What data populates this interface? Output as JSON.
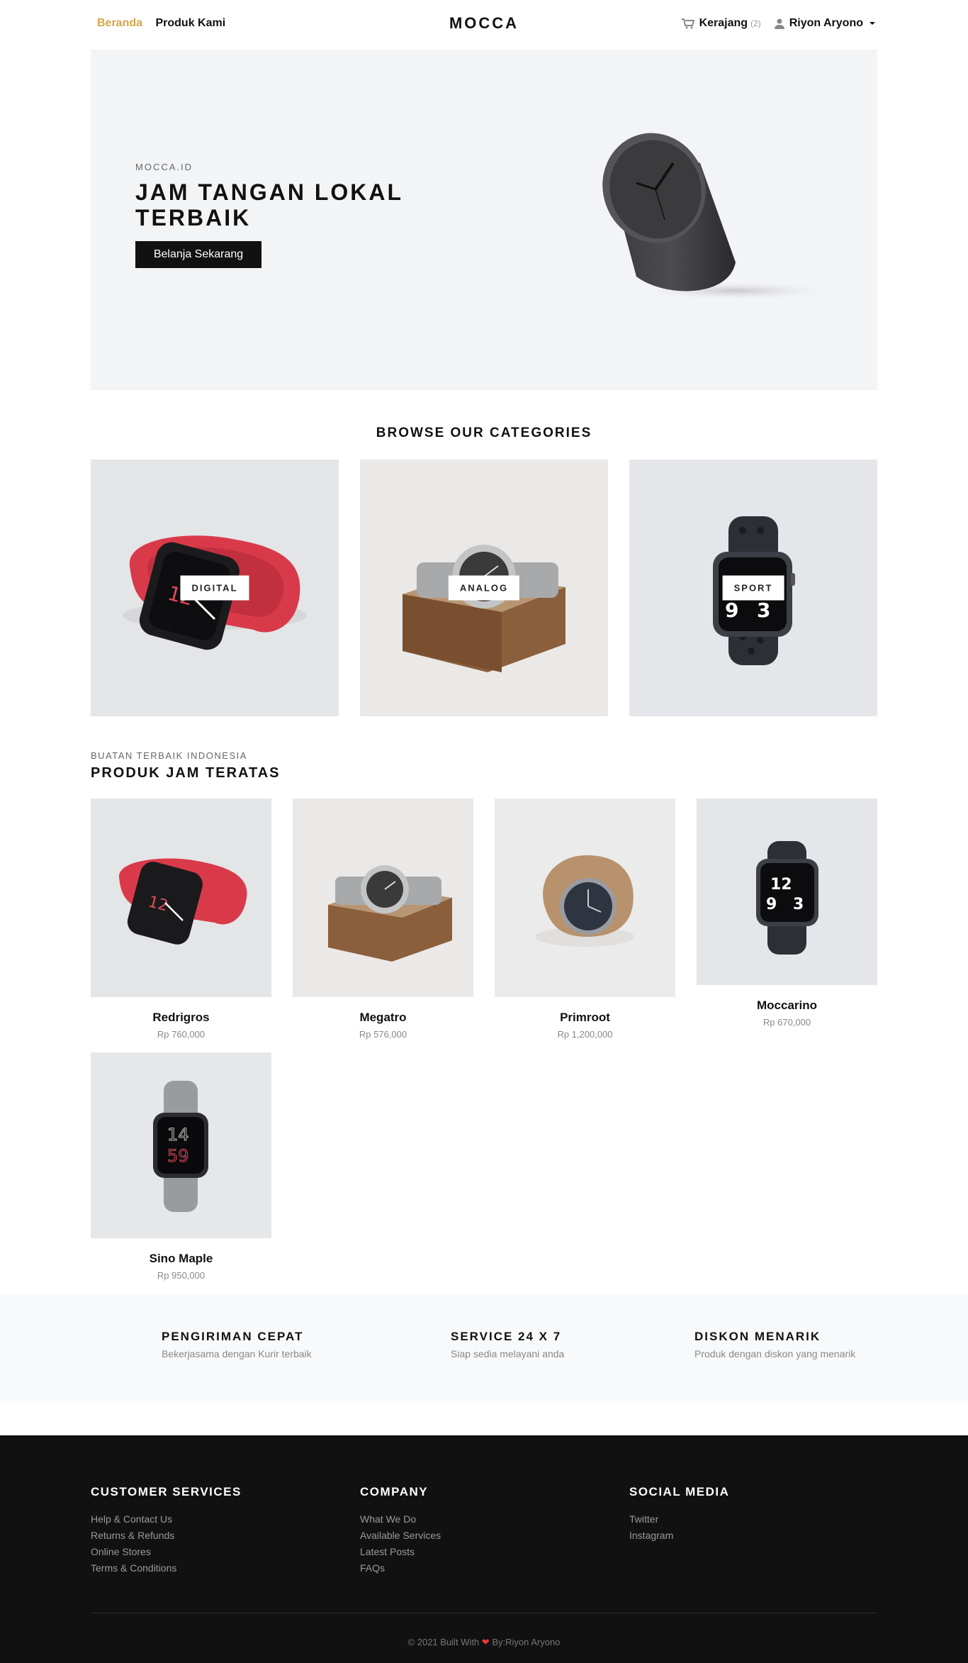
{
  "nav": {
    "home": "Beranda",
    "products": "Produk Kami",
    "brand": "MOCCA",
    "cart_label": "Kerajang",
    "cart_count": "(2)",
    "user_name": "Riyon Aryono"
  },
  "hero": {
    "eyebrow": "MOCCA.ID",
    "title": "JAM TANGAN LOKAL TERBAIK",
    "button": "Belanja Sekarang"
  },
  "categories": {
    "title": "BROWSE OUR CATEGORIES",
    "items": [
      {
        "label": "DIGITAL"
      },
      {
        "label": "ANALOG"
      },
      {
        "label": "SPORT"
      }
    ]
  },
  "products": {
    "eyebrow": "BUATAN TERBAIK INDONESIA",
    "title": "PRODUK JAM TERATAS",
    "items": [
      {
        "name": "Redrigros",
        "price": "Rp 760,000"
      },
      {
        "name": "Megatro",
        "price": "Rp 576,000"
      },
      {
        "name": "Primroot",
        "price": "Rp 1,200,000"
      },
      {
        "name": "Moccarino",
        "price": "Rp 670,000"
      },
      {
        "name": "Sino Maple",
        "price": "Rp 950,000"
      }
    ]
  },
  "features": [
    {
      "title": "PENGIRIMAN CEPAT",
      "desc": "Bekerjasama dengan Kurir terbaik"
    },
    {
      "title": "SERVICE 24 X 7",
      "desc": "Siap sedia melayani anda"
    },
    {
      "title": "DISKON MENARIK",
      "desc": "Produk dengan diskon yang menarik"
    }
  ],
  "footer": {
    "customer": {
      "title": "CUSTOMER SERVICES",
      "links": [
        "Help & Contact Us",
        "Returns & Refunds",
        "Online Stores",
        "Terms & Conditions"
      ]
    },
    "company": {
      "title": "COMPANY",
      "links": [
        "What We Do",
        "Available Services",
        "Latest Posts",
        "FAQs"
      ]
    },
    "social": {
      "title": "SOCIAL MEDIA",
      "links": [
        "Twitter",
        "Instagram"
      ]
    },
    "copyright_prefix": "© 2021 Built With",
    "copyright_suffix": "By:Riyon Aryono"
  }
}
